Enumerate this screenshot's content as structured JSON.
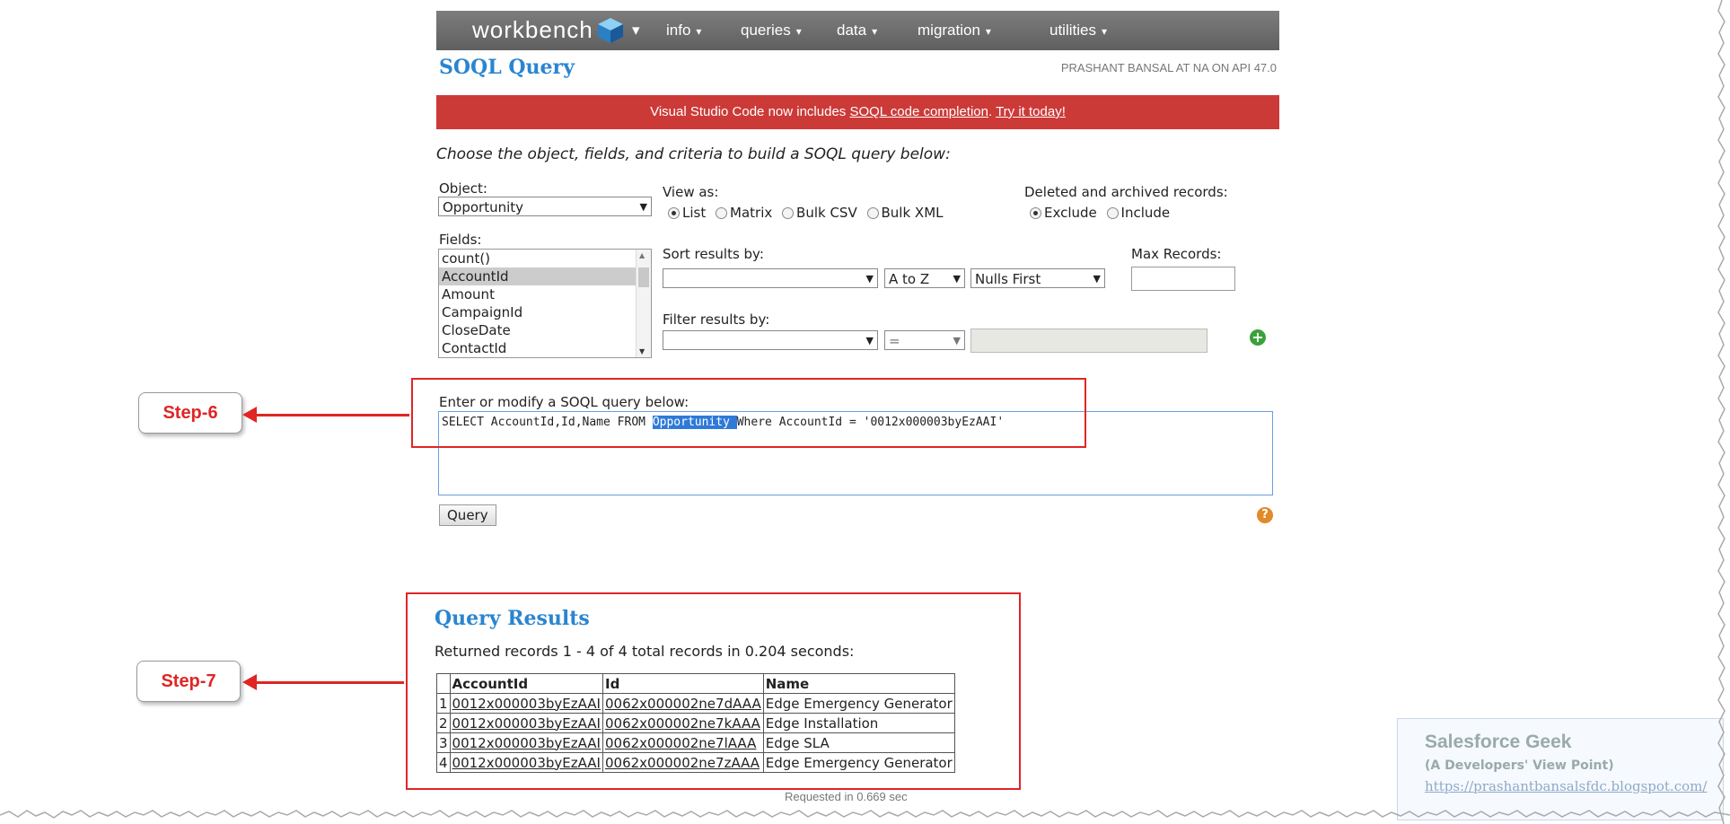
{
  "nav": {
    "brand": "workbench",
    "menus": [
      "info",
      "queries",
      "data",
      "migration",
      "utilities"
    ]
  },
  "page": {
    "title": "SOQL Query",
    "user": "PRASHANT BANSAL AT NA ON API 47.0"
  },
  "banner": {
    "prefix": "Visual Studio Code now includes ",
    "link1": "SOQL code completion",
    "sep": ". ",
    "link2": "Try it today!"
  },
  "intro": "Choose the object, fields, and criteria to build a SOQL query below:",
  "object": {
    "label": "Object:",
    "value": "Opportunity"
  },
  "view_as": {
    "label": "View as:",
    "options": [
      "List",
      "Matrix",
      "Bulk CSV",
      "Bulk XML"
    ],
    "selected": "List"
  },
  "deleted": {
    "label": "Deleted and archived records:",
    "options": [
      "Exclude",
      "Include"
    ],
    "selected": "Exclude"
  },
  "fields": {
    "label": "Fields:",
    "items": [
      "count()",
      "AccountId",
      "Amount",
      "CampaignId",
      "CloseDate",
      "ContactId"
    ],
    "selected": "AccountId"
  },
  "sort": {
    "label": "Sort results by:",
    "field": "",
    "direction": "A to Z",
    "nulls": "Nulls First"
  },
  "max_records": {
    "label": "Max Records:",
    "value": ""
  },
  "filter": {
    "label": "Filter results by:",
    "field": "",
    "operator": "=",
    "value": ""
  },
  "query": {
    "label": "Enter or modify a SOQL query below:",
    "before": "SELECT AccountId,Id,Name FROM ",
    "highlight": "Opportunity ",
    "after": "Where AccountId = '0012x000003byEzAAI'",
    "button": "Query"
  },
  "steps": {
    "step6": "Step-6",
    "step7": "Step-7"
  },
  "results": {
    "title": "Query Results",
    "summary": "Returned records 1 - 4 of 4 total records in 0.204 seconds:",
    "columns": [
      "AccountId",
      "Id",
      "Name"
    ],
    "rows": [
      [
        "1",
        "0012x000003byEzAAI",
        "0062x000002ne7dAAA",
        "Edge Emergency Generator"
      ],
      [
        "2",
        "0012x000003byEzAAI",
        "0062x000002ne7kAAA",
        "Edge Installation"
      ],
      [
        "3",
        "0012x000003byEzAAI",
        "0062x000002ne7lAAA",
        "Edge SLA"
      ],
      [
        "4",
        "0012x000003byEzAAI",
        "0062x000002ne7zAAA",
        "Edge Emergency Generator"
      ]
    ]
  },
  "footer": "Requested in 0.669 sec",
  "watermark": {
    "title": "Salesforce Geek",
    "subtitle": "(A Developers' View Point)",
    "url": "https://prashantbansalsfdc.blogspot.com/"
  },
  "colors": {
    "accent": "#2a85d0",
    "banner": "#cc3a38",
    "annotation": "#e02525"
  },
  "icons": [
    "cube-icon",
    "plus-icon",
    "help-icon"
  ]
}
